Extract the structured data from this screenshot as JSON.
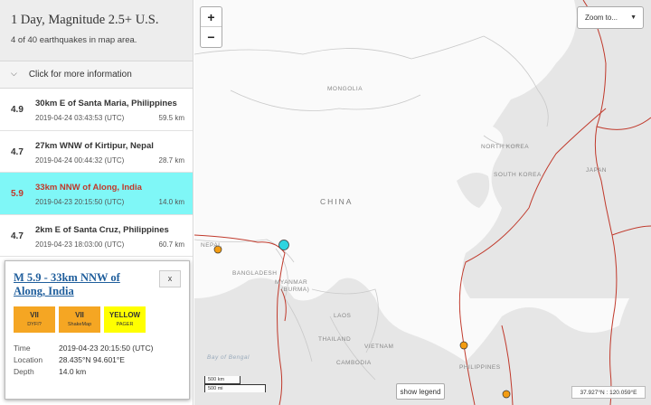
{
  "header": {
    "title": "1 Day, Magnitude 2.5+ U.S.",
    "subtitle": "4 of 40 earthquakes in map area."
  },
  "more_info": {
    "label": "Click for more information"
  },
  "earthquakes": [
    {
      "magnitude": "4.9",
      "place": "30km E of Santa Maria, Philippines",
      "time": "2019-04-24 03:43:53 (UTC)",
      "depth": "59.5 km"
    },
    {
      "magnitude": "4.7",
      "place": "27km WNW of Kirtipur, Nepal",
      "time": "2019-04-24 00:44:32 (UTC)",
      "depth": "28.7 km"
    },
    {
      "magnitude": "5.9",
      "place": "33km NNW of Along, India",
      "time": "2019-04-23 20:15:50 (UTC)",
      "depth": "14.0 km"
    },
    {
      "magnitude": "4.7",
      "place": "2km E of Santa Cruz, Philippines",
      "time": "2019-04-23 18:03:00 (UTC)",
      "depth": "60.7 km"
    }
  ],
  "popup": {
    "title": "M 5.9 - 33km NNW of Along, India",
    "close_label": "x",
    "badges": [
      {
        "value": "VII",
        "label": "DYFI?"
      },
      {
        "value": "VII",
        "label": "ShakeMap"
      },
      {
        "value": "YELLOW",
        "label": "PAGER"
      }
    ],
    "details": [
      {
        "label": "Time",
        "value": "2019-04-23 20:15:50 (UTC)"
      },
      {
        "label": "Location",
        "value": "28.435°N 94.601°E"
      },
      {
        "label": "Depth",
        "value": "14.0 km"
      }
    ]
  },
  "map": {
    "zoom_in": "+",
    "zoom_out": "−",
    "zoom_to": "Zoom to...",
    "scale_km": "500 km",
    "scale_mi": "500 mi",
    "legend_button": "show legend",
    "coordinates": "37.927°N : 120.059°E",
    "labels": {
      "mongolia": "MONGOLIA",
      "china": "CHINA",
      "north_korea": "NORTH KOREA",
      "south_korea": "SOUTH KOREA",
      "japan": "JAPAN",
      "nepal": "NEPAL",
      "bangladesh": "BANGLADESH",
      "myanmar": "MYANMAR",
      "burma": "(BURMA)",
      "laos": "LAOS",
      "thailand": "THAILAND",
      "vietnam": "VIETNAM",
      "cambodia": "CAMBODIA",
      "philippines": "PHILIPPINES",
      "bay_of_bengal": "Bay of Bengal"
    }
  },
  "colors": {
    "selected_row": "#7ff7f7",
    "selected_text": "#c0392b",
    "link": "#1f5e9c",
    "badge_orange": "#f5a623",
    "badge_yellow": "#ffff00",
    "plate_boundary": "#c0392b",
    "quake_orange": "#f39c12",
    "quake_selected": "#2dd4e0"
  }
}
